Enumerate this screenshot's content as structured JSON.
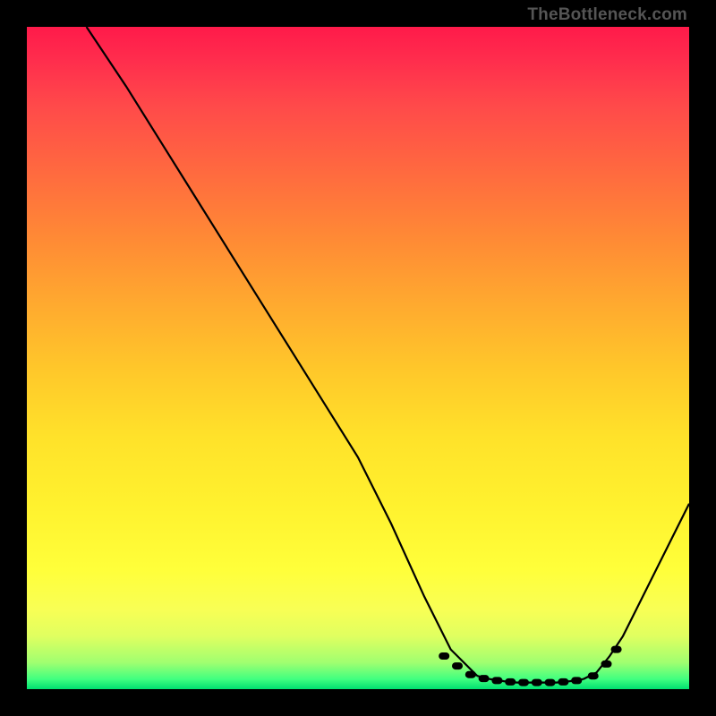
{
  "watermark": "TheBottleneck.com",
  "colors": {
    "background": "#000000",
    "gradient_top": "#ff1a4a",
    "gradient_mid": "#ffe22a",
    "gradient_bottom": "#00e070",
    "curve": "#000000",
    "dots": "#dd6f6b"
  },
  "chart_data": {
    "type": "line",
    "title": "",
    "xlabel": "",
    "ylabel": "",
    "xlim": [
      0,
      100
    ],
    "ylim": [
      0,
      100
    ],
    "grid": false,
    "series": [
      {
        "name": "left-curve",
        "x": [
          9,
          15,
          20,
          25,
          30,
          35,
          40,
          45,
          50,
          55,
          60,
          62,
          64,
          66,
          68
        ],
        "values": [
          100,
          91,
          83,
          75,
          67,
          59,
          51,
          43,
          35,
          25,
          14,
          10,
          6,
          4,
          2
        ]
      },
      {
        "name": "valley-floor",
        "x": [
          68,
          70,
          72,
          74,
          76,
          78,
          80,
          82,
          84
        ],
        "values": [
          2,
          1.5,
          1.2,
          1.0,
          1.0,
          1.0,
          1.0,
          1.2,
          1.5
        ]
      },
      {
        "name": "right-curve",
        "x": [
          84,
          86,
          88,
          90,
          92,
          94,
          96,
          98,
          100
        ],
        "values": [
          1.5,
          2.5,
          5,
          8,
          12,
          16,
          20,
          24,
          28
        ]
      }
    ],
    "markers": [
      {
        "x": 63.0,
        "y": 5.0
      },
      {
        "x": 65.0,
        "y": 3.5
      },
      {
        "x": 67.0,
        "y": 2.2
      },
      {
        "x": 69.0,
        "y": 1.6
      },
      {
        "x": 71.0,
        "y": 1.3
      },
      {
        "x": 73.0,
        "y": 1.1
      },
      {
        "x": 75.0,
        "y": 1.0
      },
      {
        "x": 77.0,
        "y": 1.0
      },
      {
        "x": 79.0,
        "y": 1.0
      },
      {
        "x": 81.0,
        "y": 1.1
      },
      {
        "x": 83.0,
        "y": 1.3
      },
      {
        "x": 85.5,
        "y": 2.0
      },
      {
        "x": 87.5,
        "y": 3.8
      },
      {
        "x": 89.0,
        "y": 6.0
      }
    ]
  }
}
